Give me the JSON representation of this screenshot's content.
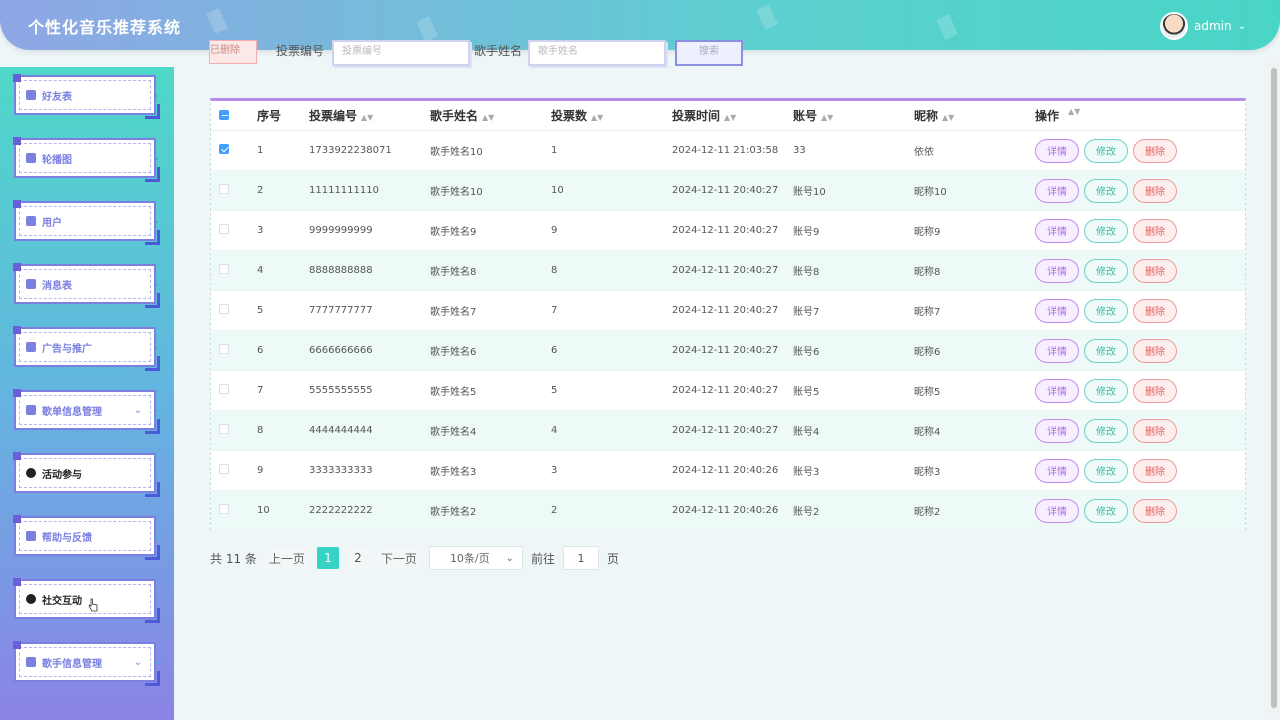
{
  "app": {
    "title": "个性化音乐推荐系统",
    "user": "admin"
  },
  "sidebar": {
    "items": [
      {
        "label": "好友表",
        "dark": false,
        "arrow": false
      },
      {
        "label": "轮播图",
        "dark": false,
        "arrow": false
      },
      {
        "label": "用户",
        "dark": false,
        "arrow": false
      },
      {
        "label": "消息表",
        "dark": false,
        "arrow": false
      },
      {
        "label": "广告与推广",
        "dark": false,
        "arrow": false
      },
      {
        "label": "歌单信息管理",
        "dark": false,
        "arrow": true
      },
      {
        "label": "活动参与",
        "dark": true,
        "arrow": false
      },
      {
        "label": "帮助与反馈",
        "dark": false,
        "arrow": false
      },
      {
        "label": "社交互动",
        "dark": true,
        "arrow": false
      },
      {
        "label": "歌手信息管理",
        "dark": false,
        "arrow": true
      }
    ]
  },
  "filter": {
    "btn_label": "已删除",
    "vote_code_label": "投票编号",
    "vote_code_placeholder": "投票编号",
    "singer_label": "歌手姓名",
    "singer_placeholder": "歌手姓名",
    "search_label": "搜索"
  },
  "table": {
    "headers": [
      "序号",
      "投票编号",
      "歌手姓名",
      "投票数",
      "投票时间",
      "账号",
      "昵称",
      "操作"
    ],
    "ops": {
      "detail": "详情",
      "edit": "修改",
      "delete": "删除"
    },
    "rows": [
      {
        "idx": "1",
        "code": "1733922238071",
        "singer": "歌手姓名10",
        "votes": "1",
        "time": "2024-12-11 21:03:58",
        "account": "33",
        "nick": "依依",
        "checked": true
      },
      {
        "idx": "2",
        "code": "11111111110",
        "singer": "歌手姓名10",
        "votes": "10",
        "time": "2024-12-11 20:40:27",
        "account": "账号10",
        "nick": "昵称10",
        "checked": false
      },
      {
        "idx": "3",
        "code": "9999999999",
        "singer": "歌手姓名9",
        "votes": "9",
        "time": "2024-12-11 20:40:27",
        "account": "账号9",
        "nick": "昵称9",
        "checked": false
      },
      {
        "idx": "4",
        "code": "8888888888",
        "singer": "歌手姓名8",
        "votes": "8",
        "time": "2024-12-11 20:40:27",
        "account": "账号8",
        "nick": "昵称8",
        "checked": false
      },
      {
        "idx": "5",
        "code": "7777777777",
        "singer": "歌手姓名7",
        "votes": "7",
        "time": "2024-12-11 20:40:27",
        "account": "账号7",
        "nick": "昵称7",
        "checked": false
      },
      {
        "idx": "6",
        "code": "6666666666",
        "singer": "歌手姓名6",
        "votes": "6",
        "time": "2024-12-11 20:40:27",
        "account": "账号6",
        "nick": "昵称6",
        "checked": false
      },
      {
        "idx": "7",
        "code": "5555555555",
        "singer": "歌手姓名5",
        "votes": "5",
        "time": "2024-12-11 20:40:27",
        "account": "账号5",
        "nick": "昵称5",
        "checked": false
      },
      {
        "idx": "8",
        "code": "4444444444",
        "singer": "歌手姓名4",
        "votes": "4",
        "time": "2024-12-11 20:40:27",
        "account": "账号4",
        "nick": "昵称4",
        "checked": false
      },
      {
        "idx": "9",
        "code": "3333333333",
        "singer": "歌手姓名3",
        "votes": "3",
        "time": "2024-12-11 20:40:26",
        "account": "账号3",
        "nick": "昵称3",
        "checked": false
      },
      {
        "idx": "10",
        "code": "2222222222",
        "singer": "歌手姓名2",
        "votes": "2",
        "time": "2024-12-11 20:40:26",
        "account": "账号2",
        "nick": "昵称2",
        "checked": false
      }
    ]
  },
  "pager": {
    "total": "共 11 条",
    "prev": "上一页",
    "pages": [
      "1",
      "2"
    ],
    "active": "1",
    "next": "下一页",
    "size": "10条/页",
    "goto": "前往",
    "goto_value": "1",
    "page_unit": "页"
  },
  "icons": {
    "chevron": "chevron-down-icon",
    "sort": "sort-icon",
    "menu": "menu-grid-icon"
  },
  "colors": {
    "accent": "#37d3c6",
    "sidebar_border": "#7b7fe0",
    "header_purple": "#b58ce6"
  }
}
